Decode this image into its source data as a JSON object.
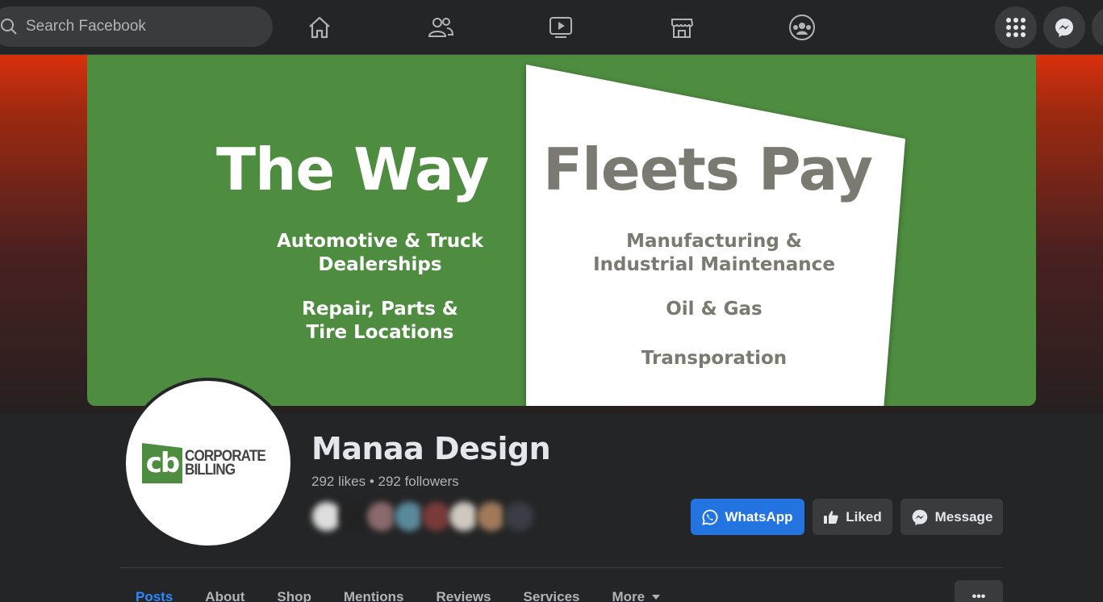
{
  "search": {
    "placeholder": "Search Facebook"
  },
  "nav": {
    "icons": [
      "home-icon",
      "friends-icon",
      "watch-icon",
      "marketplace-icon",
      "groups-icon"
    ],
    "right_icons": [
      "menu-grid-icon",
      "messenger-icon"
    ]
  },
  "cover": {
    "title_left": "The Way",
    "title_right": "Fleets Pay",
    "left_lines": [
      "Automotive & Truck",
      "Dealerships",
      "Repair, Parts &",
      "Tire Locations"
    ],
    "right_lines": [
      "Manufacturing &",
      "Industrial Maintenance",
      "Oil & Gas",
      "Transporation"
    ],
    "colors": {
      "green": "#4e8c40",
      "grey_text": "#7a7a72"
    }
  },
  "logo": {
    "mark": "cb",
    "word1": "CORPORATE",
    "word2": "BILLING"
  },
  "page": {
    "name": "Manaa Design",
    "stats": "292 likes • 292 followers"
  },
  "actions": {
    "whatsapp": "WhatsApp",
    "liked": "Liked",
    "message": "Message"
  },
  "tabs": [
    "Posts",
    "About",
    "Shop",
    "Mentions",
    "Reviews",
    "Services",
    "More"
  ],
  "more_menu": "•••",
  "colors": {
    "accent": "#2374e1",
    "active_tab": "#2d88ff",
    "surface": "#242526"
  }
}
